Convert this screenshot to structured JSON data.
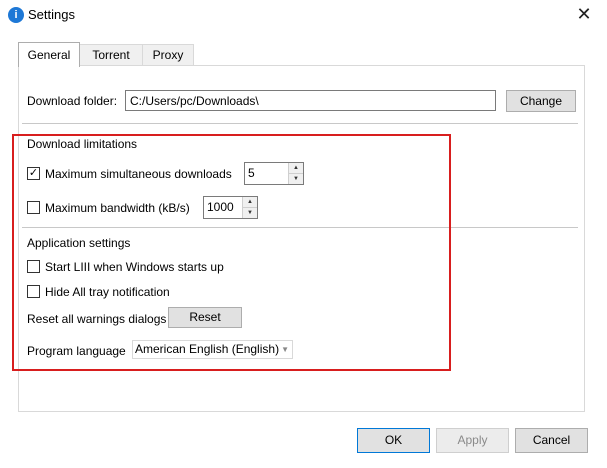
{
  "window": {
    "title": "Settings",
    "icon": "app-info-icon",
    "close_glyph": "✕"
  },
  "tabs": [
    {
      "label": "General",
      "active": true
    },
    {
      "label": "Torrent",
      "active": false
    },
    {
      "label": "Proxy",
      "active": false
    }
  ],
  "download_folder": {
    "label": "Download folder:",
    "value": "C:/Users/pc/Downloads\\",
    "change_button": "Change"
  },
  "download_limitations": {
    "heading": "Download limitations",
    "max_downloads": {
      "label": "Maximum simultaneous downloads",
      "checked": true,
      "value": "5"
    },
    "max_bandwidth": {
      "label": "Maximum bandwidth (kB/s)",
      "checked": false,
      "value": "1000"
    }
  },
  "application_settings": {
    "heading": "Application settings",
    "start_with_windows": {
      "label": "Start LIII when Windows starts up",
      "checked": false
    },
    "hide_tray": {
      "label": "Hide All tray notification",
      "checked": false
    },
    "reset_warnings": {
      "label": "Reset all warnings dialogs",
      "button": "Reset"
    },
    "language": {
      "label": "Program language",
      "value": "American English (English)"
    }
  },
  "footer": {
    "ok": "OK",
    "apply": "Apply",
    "cancel": "Cancel"
  },
  "colors": {
    "highlight": "#d81e1e",
    "accent": "#0078d7"
  }
}
